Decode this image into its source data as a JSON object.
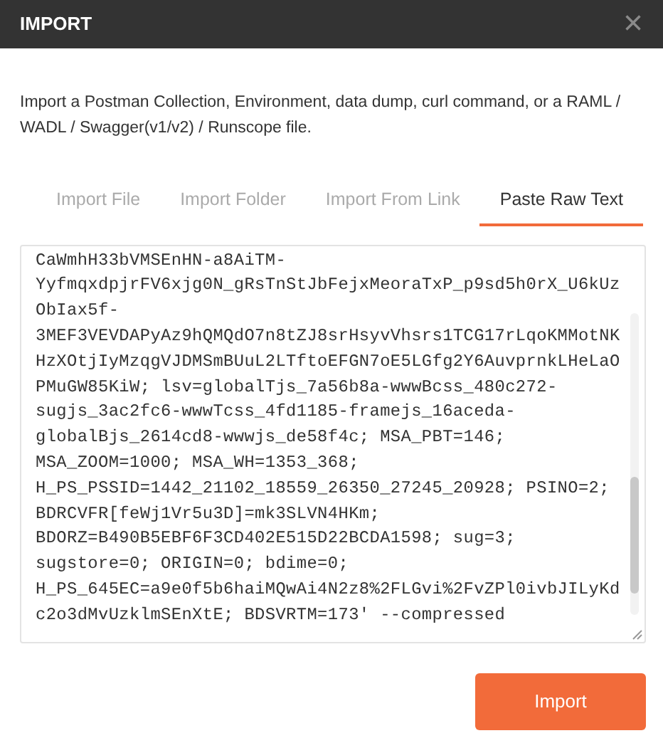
{
  "dialog": {
    "title": "IMPORT",
    "close": "×"
  },
  "description": "Import a Postman Collection, Environment, data dump, curl command, or a RAML / WADL / Swagger(v1/v2) / Runscope file.",
  "tabs": [
    {
      "label": "Import File",
      "selected": false
    },
    {
      "label": "Import Folder",
      "selected": false
    },
    {
      "label": "Import From Link",
      "selected": false
    },
    {
      "label": "Paste Raw Text",
      "selected": true
    }
  ],
  "raw_text": {
    "lines": [
      "CaWmhH33bVMSEnHN-a8AiTM-",
      "YyfmqxdpjrFV6xjg0N_gRsTnStJbFejxMeoraTxP_p9sd5h0rX_U6kUz",
      "ObIax5f-",
      "3MEF3VEVDAPyAz9hQMQdO7n8tZJ8srHsyvVhsrs1TCG17rLqoKMMotNK",
      "HzXOtjIyMzqgVJDMSmBUuL2LTftoEFGN7oE5LGfg2Y6AuvprnkLHeLaO",
      "PMuGW85KiW; lsv=globalTjs_7a56b8a-wwwBcss_480c272-",
      "sugjs_3ac2fc6-wwwTcss_4fd1185-framejs_16aceda-",
      "globalBjs_2614cd8-wwwjs_de58f4c; MSA_PBT=146;",
      "MSA_ZOOM=1000; MSA_WH=1353_368;",
      "H_PS_PSSID=1442_21102_18559_26350_27245_20928; PSINO=2;",
      "BDRCVFR[feWj1Vr5u3D]=mk3SLVN4HKm;",
      "BDORZ=B490B5EBF6F3CD402E515D22BCDA1598; sug=3;",
      "sugstore=0; ORIGIN=0; bdime=0;",
      "H_PS_645EC=a9e0f5b6haiMQwAi4N2z8%2FLGvi%2FvZPl0ivbJILyKd",
      "c2o3dMvUzklmSEnXtE; BDSVRTM=173' --compressed"
    ]
  },
  "buttons": [
    {
      "label": "Import"
    }
  ]
}
